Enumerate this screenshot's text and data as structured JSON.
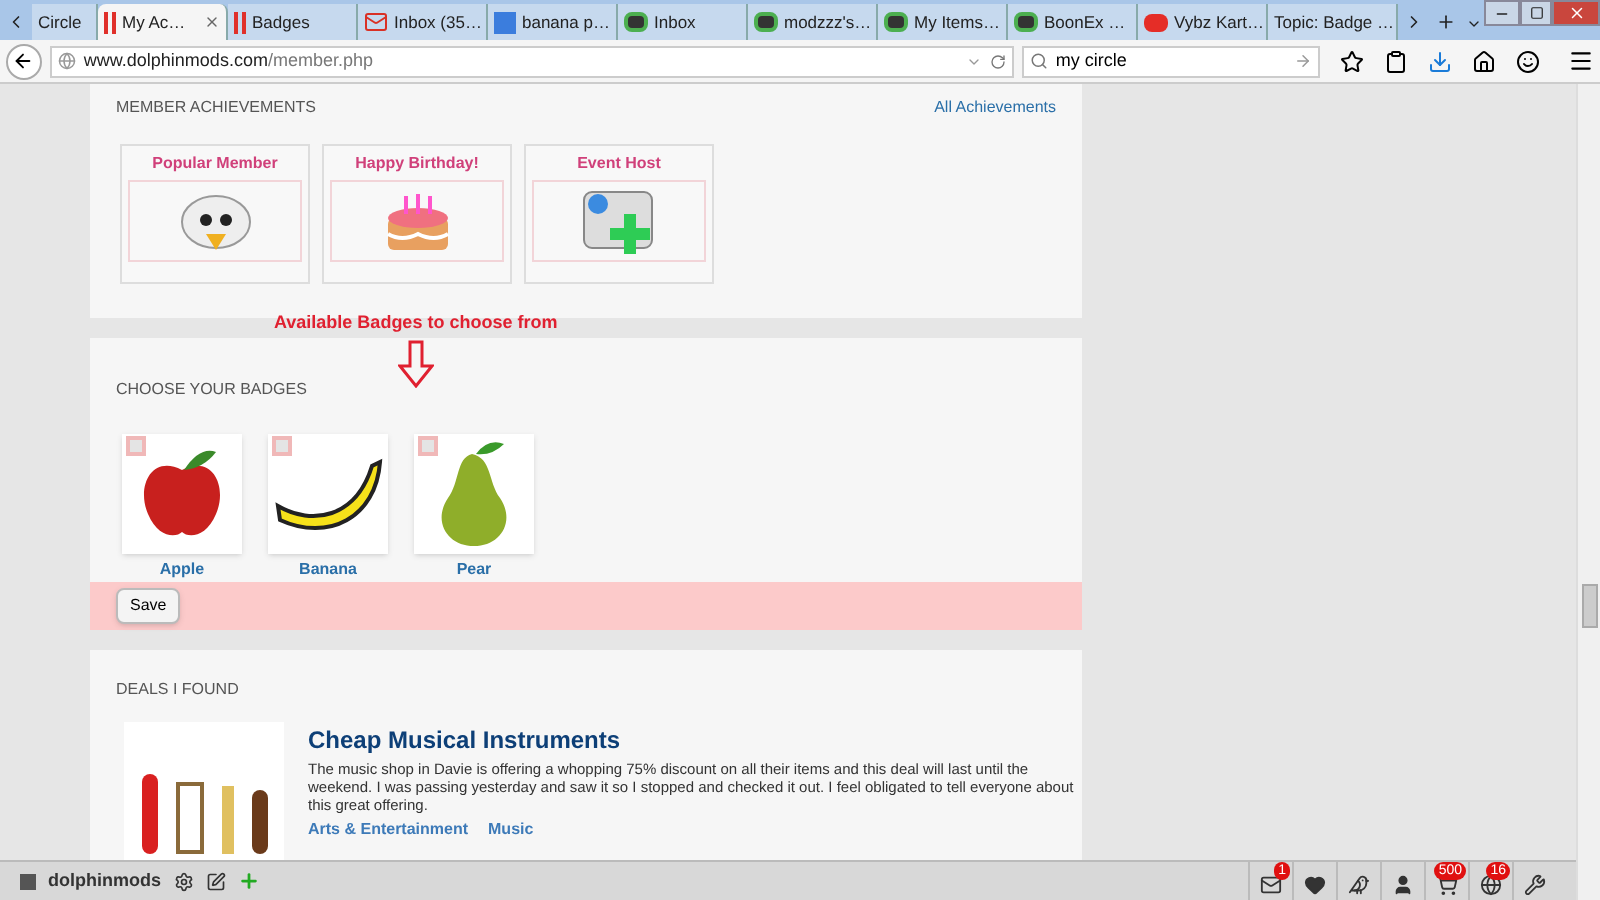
{
  "browser": {
    "tabs": [
      {
        "label": "Circle",
        "selected": false,
        "kind": "plain"
      },
      {
        "label": "My Ac…",
        "selected": true,
        "kind": "bars"
      },
      {
        "label": "Badges",
        "selected": false,
        "kind": "bars"
      },
      {
        "label": "Inbox (35…",
        "selected": false,
        "kind": "mail"
      },
      {
        "label": "banana p…",
        "selected": false,
        "kind": "search"
      },
      {
        "label": "Inbox",
        "selected": false,
        "kind": "site"
      },
      {
        "label": "modzzz's…",
        "selected": false,
        "kind": "site"
      },
      {
        "label": "My Items…",
        "selected": false,
        "kind": "site"
      },
      {
        "label": "BoonEx …",
        "selected": false,
        "kind": "site"
      },
      {
        "label": "Vybz Kart…",
        "selected": false,
        "kind": "video"
      },
      {
        "label": "Topic: Badge …",
        "selected": false,
        "kind": "plain"
      }
    ],
    "url_host": "www.dolphinmods.com",
    "url_path": "/member.php",
    "search_value": "my circle"
  },
  "achievements": {
    "title": "MEMBER ACHIEVEMENTS",
    "link": "All Achievements",
    "items": [
      {
        "title": "Popular Member",
        "kind": "bird"
      },
      {
        "title": "Happy Birthday!",
        "kind": "cake"
      },
      {
        "title": "Event Host",
        "kind": "host"
      }
    ]
  },
  "annotation": "Available Badges to choose from",
  "badges": {
    "title": "CHOOSE YOUR BADGES",
    "items": [
      {
        "label": "Apple",
        "kind": "apple",
        "checked": false
      },
      {
        "label": "Banana",
        "kind": "banana",
        "checked": false
      },
      {
        "label": "Pear",
        "kind": "pear",
        "checked": false
      }
    ],
    "save": "Save"
  },
  "deals": {
    "title": "DEALS I FOUND",
    "items": [
      {
        "title": "Cheap Musical Instruments",
        "text": "The music shop in Davie is offering a whopping 75% discount on all their items and this deal will last until the weekend. I was passing yesterday and saw it so I stopped and checked it out. I feel obligated to tell everyone about this great offering.",
        "category": "Arts & Entertainment",
        "subcategory": "Music"
      }
    ]
  },
  "bottom_bar": {
    "site": "dolphinmods",
    "counters": [
      {
        "kind": "mail",
        "count": "1"
      },
      {
        "kind": "heart"
      },
      {
        "kind": "bird"
      },
      {
        "kind": "person"
      },
      {
        "kind": "cart",
        "count": "500"
      },
      {
        "kind": "globe",
        "count": "16"
      },
      {
        "kind": "wrench"
      }
    ]
  }
}
